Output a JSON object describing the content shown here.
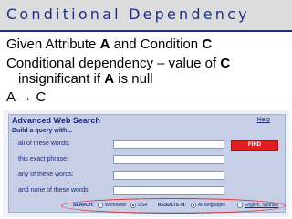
{
  "slide": {
    "title": "Conditional Dependency",
    "bullet1": {
      "prefix": "Given Attribute ",
      "attr": "A",
      "middle": " and Condition ",
      "cond": "C"
    },
    "bullet2": {
      "line1_prefix": "Conditional dependency – value of ",
      "line1_cond": "C",
      "line2_prefix": "insignificant if ",
      "line2_attr": "A",
      "line2_suffix": " is null"
    },
    "bullet3": "A → C"
  },
  "search_panel": {
    "title": "Advanced Web Search",
    "help_link": "Help",
    "subtitle": "Build a query with...",
    "rows": [
      {
        "label": "all of these words:"
      },
      {
        "label": "this exact phrase:"
      },
      {
        "label": "any of these words:"
      },
      {
        "label": "and none of these words"
      }
    ],
    "find_button": "FIND",
    "filters": {
      "search_label": "SEARCH:",
      "worldwide": "Worldwide",
      "usa": "USA",
      "results_label": "RESULTS IN:",
      "all_languages": "All languages",
      "english_spanish": "English, Spanish"
    }
  },
  "colors": {
    "title": "#1c2f8c",
    "panel": "#c6cfe6",
    "find": "#e02020",
    "annotation": "#e03030"
  }
}
